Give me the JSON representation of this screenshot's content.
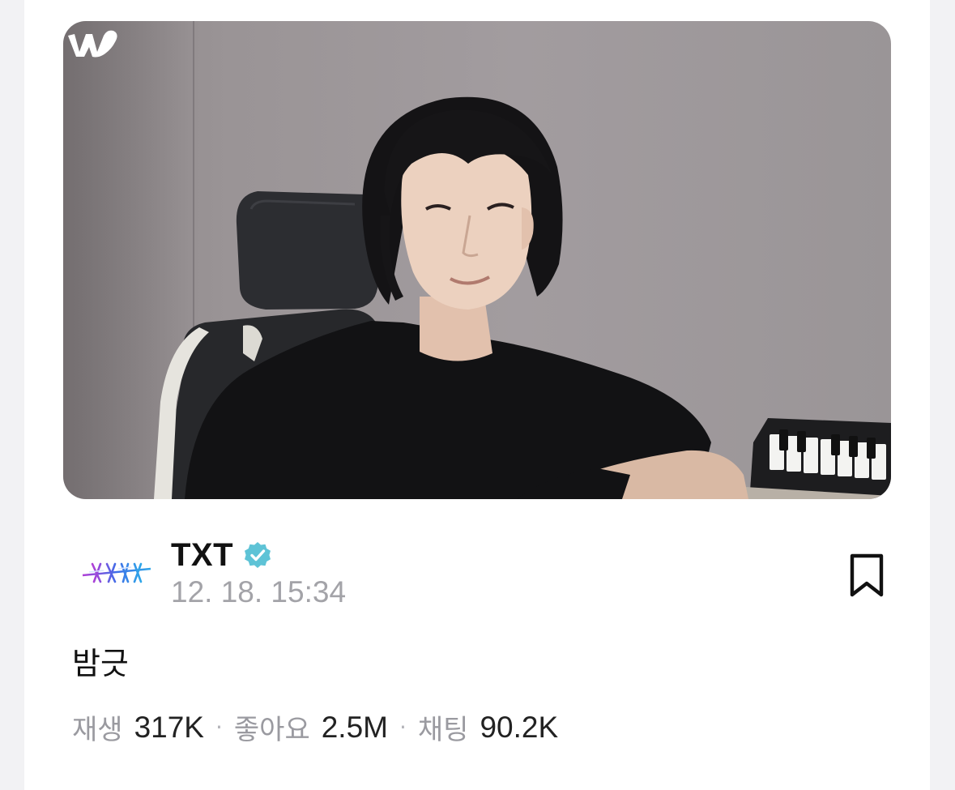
{
  "post": {
    "channel_name": "TXT",
    "verified": true,
    "timestamp": "12. 18. 15:34",
    "title": "밤긋"
  },
  "stats": {
    "plays_label": "재생",
    "plays_value": "317K",
    "likes_label": "좋아요",
    "likes_value": "2.5M",
    "chats_label": "채팅",
    "chats_value": "90.2K",
    "separator": "·"
  },
  "icons": {
    "watermark": "weverse-logo-icon",
    "verified": "verified-badge-icon",
    "bookmark": "bookmark-icon",
    "avatar": "txt-logo-avatar"
  },
  "colors": {
    "verified": "#5ec3d6",
    "text_primary": "#111111",
    "text_secondary": "#a3a3a8",
    "card_bg": "#ffffff",
    "page_bg": "#f2f2f4"
  }
}
